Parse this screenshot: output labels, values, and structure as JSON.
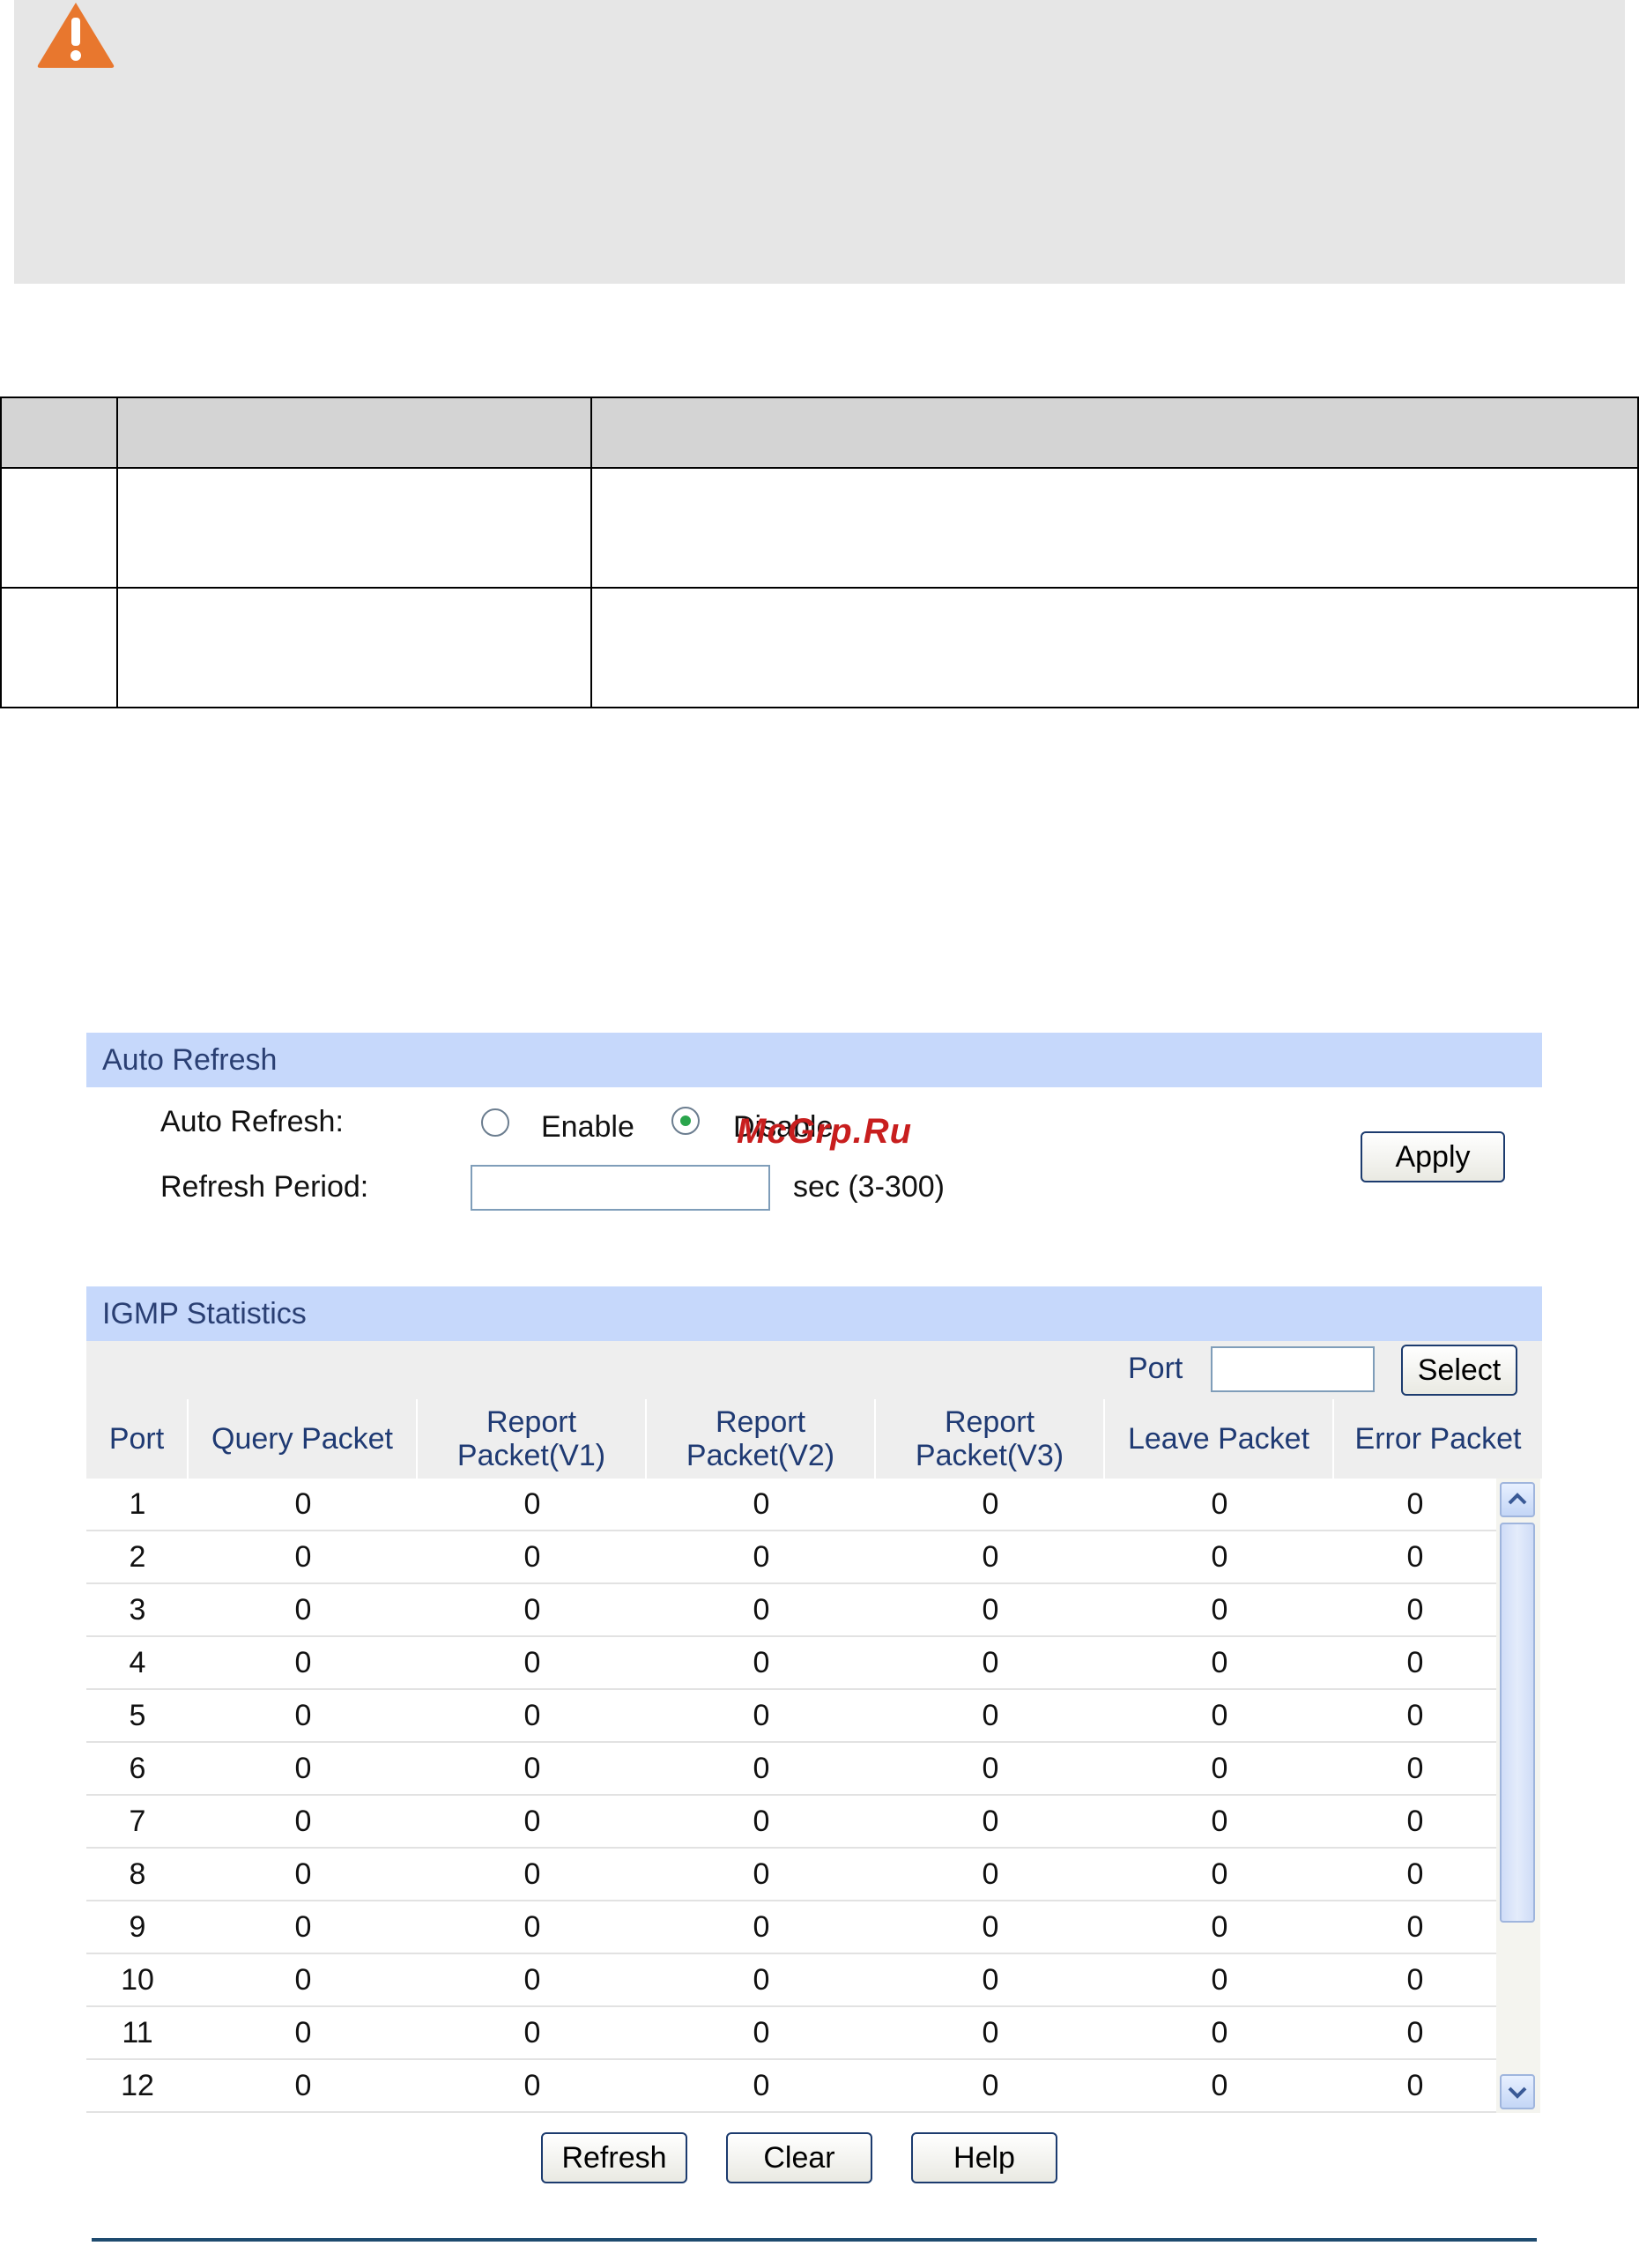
{
  "colors": {
    "section_header_bg": "#c6d8fb",
    "section_header_text": "#2a3f73",
    "warning_icon": "#e8772e",
    "watermark": "#c81e1e"
  },
  "note": {
    "icon": "warning-triangle-icon"
  },
  "spec_table": {
    "rows": 2,
    "columns": 3
  },
  "auto_refresh": {
    "header": "Auto Refresh",
    "auto_refresh_label": "Auto Refresh:",
    "enable_label": "Enable",
    "disable_label": "Disable",
    "selected": "Disable",
    "refresh_period_label": "Refresh Period:",
    "refresh_period_value": "",
    "refresh_period_unit": "sec (3-300)",
    "apply_label": "Apply"
  },
  "watermark": "McGrp.Ru",
  "igmp_statistics": {
    "header": "IGMP Statistics",
    "port_filter_label": "Port",
    "port_filter_value": "",
    "select_label": "Select",
    "columns": [
      "Port",
      "Query Packet",
      "Report Packet(V1)",
      "Report Packet(V2)",
      "Report Packet(V3)",
      "Leave Packet",
      "Error Packet"
    ],
    "rows": [
      [
        "1",
        "0",
        "0",
        "0",
        "0",
        "0",
        "0"
      ],
      [
        "2",
        "0",
        "0",
        "0",
        "0",
        "0",
        "0"
      ],
      [
        "3",
        "0",
        "0",
        "0",
        "0",
        "0",
        "0"
      ],
      [
        "4",
        "0",
        "0",
        "0",
        "0",
        "0",
        "0"
      ],
      [
        "5",
        "0",
        "0",
        "0",
        "0",
        "0",
        "0"
      ],
      [
        "6",
        "0",
        "0",
        "0",
        "0",
        "0",
        "0"
      ],
      [
        "7",
        "0",
        "0",
        "0",
        "0",
        "0",
        "0"
      ],
      [
        "8",
        "0",
        "0",
        "0",
        "0",
        "0",
        "0"
      ],
      [
        "9",
        "0",
        "0",
        "0",
        "0",
        "0",
        "0"
      ],
      [
        "10",
        "0",
        "0",
        "0",
        "0",
        "0",
        "0"
      ],
      [
        "11",
        "0",
        "0",
        "0",
        "0",
        "0",
        "0"
      ],
      [
        "12",
        "0",
        "0",
        "0",
        "0",
        "0",
        "0"
      ]
    ]
  },
  "buttons": {
    "refresh": "Refresh",
    "clear": "Clear",
    "help": "Help"
  }
}
